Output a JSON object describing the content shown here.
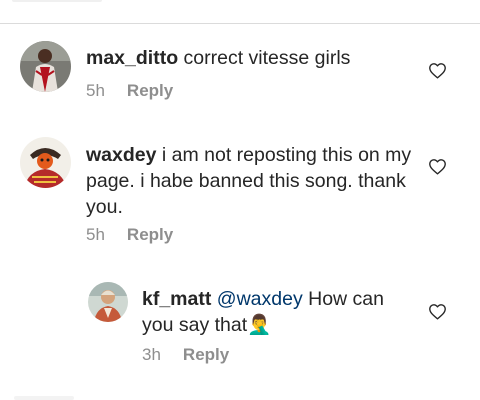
{
  "comments": [
    {
      "username": "max_ditto",
      "text": "correct vitesse girls",
      "time": "5h",
      "reply_label": "Reply",
      "like_icon": "heart-outline-icon"
    },
    {
      "username": "waxdey",
      "text": "i am not reposting this on my page. i habe banned this song. thank you.",
      "time": "5h",
      "reply_label": "Reply",
      "like_icon": "heart-outline-icon"
    },
    {
      "username": "kf_matt",
      "mention": "@waxdey",
      "text": "How can you say that",
      "emoji": "🤦‍♂️",
      "time": "3h",
      "reply_label": "Reply",
      "like_icon": "heart-outline-icon"
    }
  ],
  "colors": {
    "text": "#262626",
    "meta": "#8e8e8e",
    "mention": "#00376b",
    "divider": "#dbdbdb"
  }
}
